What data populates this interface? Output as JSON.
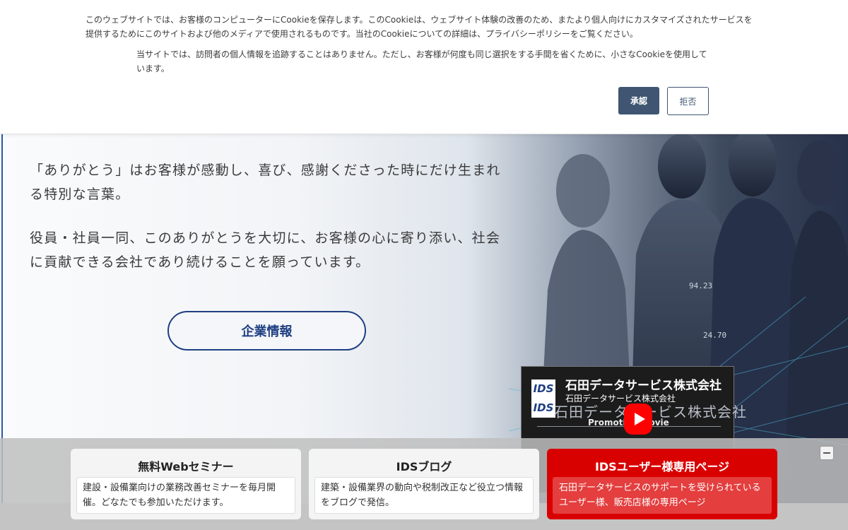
{
  "cookie_banner": {
    "text1": "このウェブサイトでは、お客様のコンピューターにCookieを保存します。このCookieは、ウェブサイト体験の改善のため、またより個人向けにカスタマイズされたサービスを提供するためにこのサイトおよび他のメディアで使用されるものです。当社のCookieについての詳細は、プライバシーポリシーをご覧ください。",
    "text2": "当サイトでは、訪問者の個人情報を追跡することはありません。ただし、お客様が何度も同じ選択をする手間を省くために、小さなCookieを使用しています。",
    "accept_label": "承認",
    "reject_label": "拒否"
  },
  "hero": {
    "paragraph1": "「ありがとう」はお客様が感動し、喜び、感謝くださった時にだけ生まれる特別な言葉。",
    "paragraph2": "役員・社員一同、このありがとうを大切に、お客様の心に寄り添い、社会に貢献できる会社であり続けることを願っています。",
    "company_button_label": "企業情報"
  },
  "video": {
    "logo_top": "IDS",
    "logo_bottom": "IDS",
    "title": "石田データサービス株式会社",
    "subtitle": "石田データサービス株式会社",
    "big_text": "石田データサービス株式会社",
    "promo_text": "Promotion Movie",
    "play_icon": "youtube-play-icon"
  },
  "cards": [
    {
      "title": "無料Webセミナー",
      "description": "建設・設備業向けの業務改善セミナーを毎月開催。どなたでも参加いただけます。"
    },
    {
      "title": "IDSブログ",
      "description": "建築・設備業界の動向や税制改正など役立つ情報をブログで発信。"
    },
    {
      "title": "IDSユーザー様専用ページ",
      "description": "石田データサービスのサポートを受けられているユーザー様、販売店様の専用ページ"
    }
  ],
  "colors": {
    "accept_bg": "#3f5571",
    "brand_navy": "#1f3f82",
    "user_card_red": "#d90000",
    "youtube_red": "#ff0000"
  }
}
